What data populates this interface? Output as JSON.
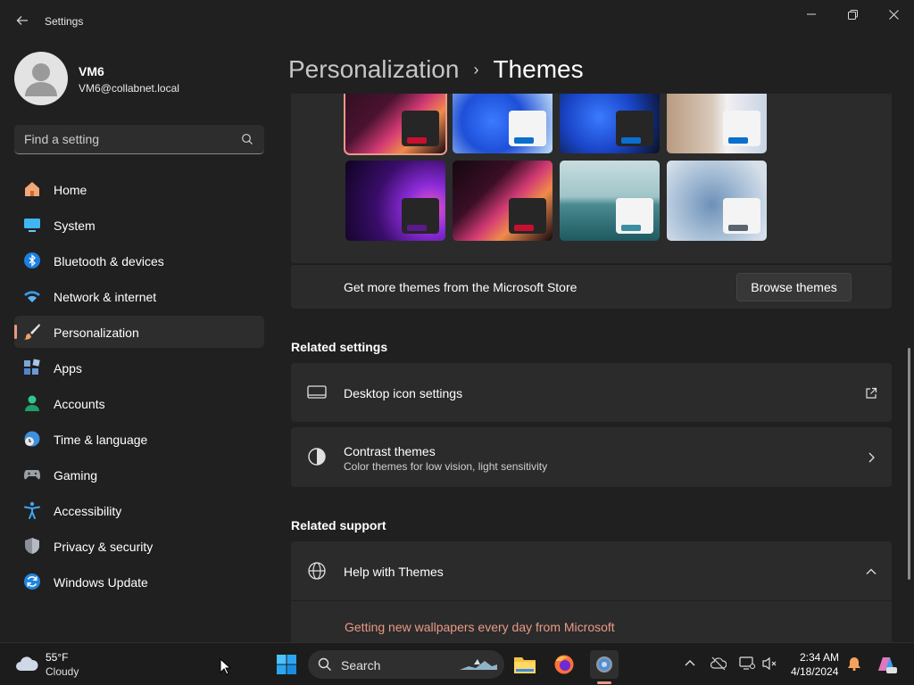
{
  "window": {
    "title": "Settings"
  },
  "user": {
    "name": "VM6",
    "email": "VM6@collabnet.local"
  },
  "search": {
    "placeholder": "Find a setting"
  },
  "nav": {
    "items": [
      {
        "label": "Home",
        "icon": "home-icon"
      },
      {
        "label": "System",
        "icon": "system-icon"
      },
      {
        "label": "Bluetooth & devices",
        "icon": "bluetooth-icon"
      },
      {
        "label": "Network & internet",
        "icon": "wifi-icon"
      },
      {
        "label": "Personalization",
        "icon": "brush-icon",
        "active": true
      },
      {
        "label": "Apps",
        "icon": "apps-icon"
      },
      {
        "label": "Accounts",
        "icon": "person-icon"
      },
      {
        "label": "Time & language",
        "icon": "clock-globe-icon"
      },
      {
        "label": "Gaming",
        "icon": "controller-icon"
      },
      {
        "label": "Accessibility",
        "icon": "accessibility-icon"
      },
      {
        "label": "Privacy & security",
        "icon": "shield-icon"
      },
      {
        "label": "Windows Update",
        "icon": "update-icon"
      }
    ]
  },
  "header": {
    "parent": "Personalization",
    "separator": "›",
    "current": "Themes"
  },
  "themes": {
    "store_text": "Get more themes from the Microsoft Store",
    "browse_label": "Browse themes",
    "tiles": [
      {
        "name": "glow-flower",
        "bar": "#c8102e",
        "selected": true
      },
      {
        "name": "bloom-light",
        "bar": "#0a6fcf"
      },
      {
        "name": "bloom-dark",
        "bar": "#0a6fcf"
      },
      {
        "name": "captured-motion",
        "bar": "#0a6fcf"
      },
      {
        "name": "glow",
        "bar": "#5b1a8a"
      },
      {
        "name": "flower-dark",
        "bar": "#c8102e"
      },
      {
        "name": "lake",
        "bar": "#3a8ea0"
      },
      {
        "name": "sunrise-bloom",
        "bar": "#5a6470"
      }
    ]
  },
  "related_settings": {
    "title": "Related settings",
    "desktop_icons": "Desktop icon settings",
    "contrast_title": "Contrast themes",
    "contrast_sub": "Color themes for low vision, light sensitivity"
  },
  "related_support": {
    "title": "Related support",
    "help_title": "Help with Themes",
    "link": "Getting new wallpapers every day from Microsoft"
  },
  "taskbar": {
    "weather_temp": "55°F",
    "weather_cond": "Cloudy",
    "search_label": "Search",
    "time": "2:34 AM",
    "date": "4/18/2024"
  },
  "colors": {
    "accent": "#e99a86",
    "background": "#202020",
    "card": "#2b2b2b"
  }
}
